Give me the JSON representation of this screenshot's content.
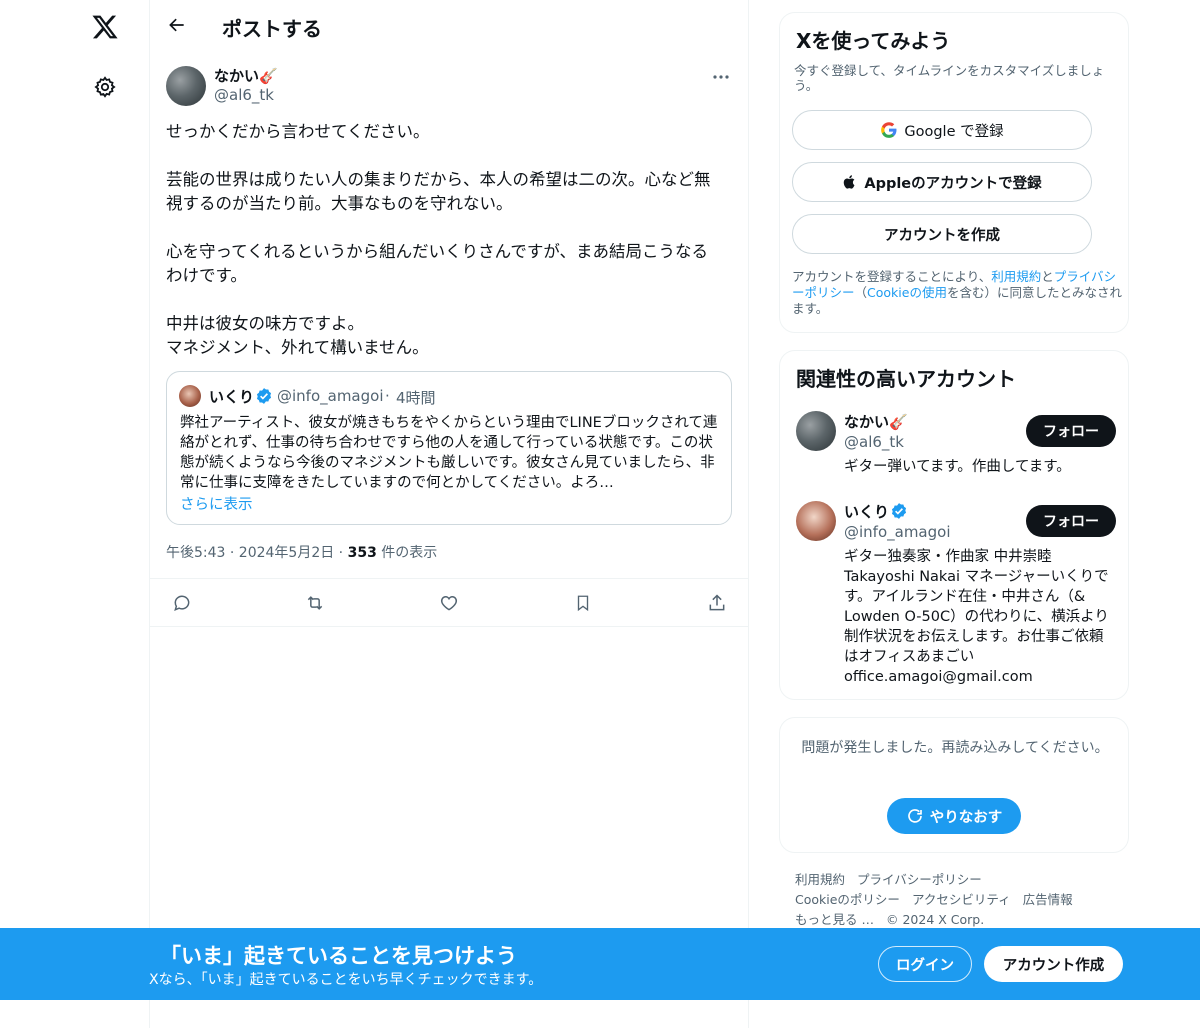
{
  "header": {
    "title": "ポストする"
  },
  "post": {
    "author_name": "なかい🎸",
    "author_handle": "@al6_tk",
    "paragraphs": [
      [
        "せっかくだから言わせてください。"
      ],
      [
        "芸能の世界は成りたい人の集まりだから、本人の希望は二の次。心など無",
        "視するのが当たり前。大事なものを守れない。"
      ],
      [
        "心を守ってくれるというから組んだいくりさんですが、まあ結局こうなる",
        "わけです。"
      ],
      [
        "中井は彼女の味方ですよ。",
        "マネジメント、外れて構いません。"
      ]
    ],
    "timestamp": "午後5:43 · 2024年5月2日 · ",
    "views_count": "353",
    "views_label": " 件の表示"
  },
  "quote": {
    "name": "いくり",
    "handle": "@info_amagoi",
    "dot": "·",
    "time": "4時間",
    "text": "弊社アーティスト、彼女が焼きもちをやくからという理由でLINEブロックされて連絡がとれず、仕事の待ち合わせですら他の人を通して行っている状態です。この状態が続くようなら今後のマネジメントも厳しいです。彼女さん見ていましたら、非常に仕事に支障をきたしていますので何とかしてください。よろ…",
    "show_more": "さらに表示"
  },
  "signup": {
    "title": "Xを使ってみよう",
    "subtitle": "今すぐ登録して、タイムラインをカスタマイズしましょう。",
    "google_label": "Google で登録",
    "apple_label": "Appleのアカウントで登録",
    "create_label": "アカウントを作成",
    "terms_prefix": "アカウントを登録することにより、",
    "terms_link": "利用規約",
    "terms_and": "と",
    "privacy_link": "プライバシーポリシー",
    "terms_paren_open": "（",
    "cookie_link": "Cookieの使用",
    "terms_suffix": "を含む）に同意したとみなされます。"
  },
  "related": {
    "title": "関連性の高いアカウント",
    "accounts": [
      {
        "name": "なかい🎸",
        "handle": "@al6_tk",
        "bio": "ギター弾いてます。作曲してます。",
        "follow": "フォロー"
      },
      {
        "name": "いくり",
        "handle": "@info_amagoi",
        "bio": "ギター独奏家・作曲家 中井崇睦Takayoshi Nakai マネージャーいくりです。アイルランド在住・中井さん（& Lowden O-50C）の代わりに、横浜より制作状況をお伝えします。お仕事ご依頼はオフィスあまごいoffice.amagoi@gmail.com",
        "follow": "フォロー"
      }
    ]
  },
  "error": {
    "text": "問題が発生しました。再読み込みしてください。",
    "retry_label": "やりなおす"
  },
  "footer": {
    "links": [
      "利用規約",
      "プライバシーポリシー",
      "Cookieのポリシー",
      "アクセシビリティ",
      "広告情報",
      "もっと見る …",
      "© 2024 X Corp."
    ]
  },
  "banner": {
    "title": "「いま」起きていることを見つけよう",
    "subtitle": "Xなら、「いま」起きていることをいち早くチェックできます。",
    "login_label": "ログイン",
    "create_label": "アカウント作成"
  },
  "colors": {
    "accent": "#1d9bf0",
    "text": "#0f1419",
    "secondary": "#536471",
    "border": "#eff3f4"
  }
}
